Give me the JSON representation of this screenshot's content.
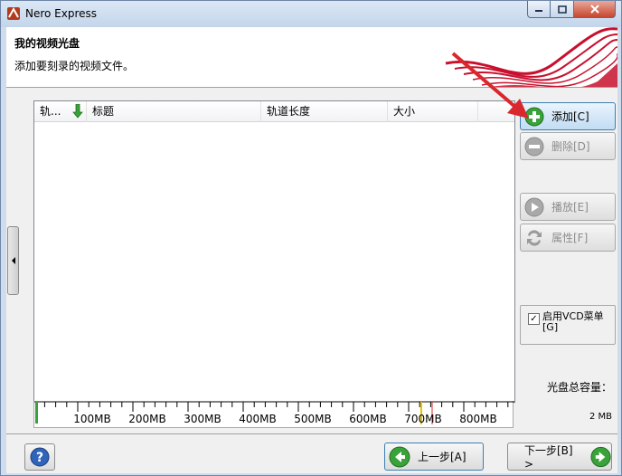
{
  "window": {
    "title": "Nero Express"
  },
  "header": {
    "title": "我的视频光盘",
    "subtitle": "添加要刻录的视频文件。"
  },
  "list": {
    "columns": [
      "轨...",
      "标题",
      "轨道长度",
      "大小"
    ]
  },
  "ruler": {
    "labels": [
      "100MB",
      "200MB",
      "300MB",
      "400MB",
      "500MB",
      "600MB",
      "700MB",
      "800MB"
    ]
  },
  "buttons": {
    "add": "添加[C]",
    "delete": "删除[D]",
    "play": "播放[E]",
    "properties": "属性[F]"
  },
  "vcd_menu": {
    "label": "启用VCD菜单[G]",
    "checked": true
  },
  "capacity": {
    "label": "光盘总容量：",
    "value": "2 MB"
  },
  "nav": {
    "back": "上一步[A]",
    "next": "下一步[B] >"
  },
  "colors": {
    "accent_red": "#d9272e",
    "green": "#3aa23a",
    "ribbon": "#c8102e"
  }
}
